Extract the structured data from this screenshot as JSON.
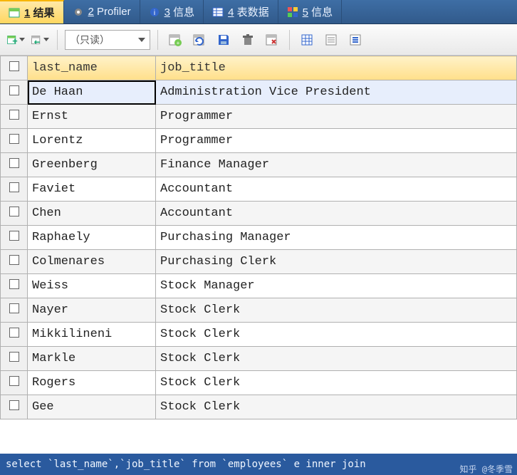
{
  "tabs": [
    {
      "num": "1",
      "label": "结果",
      "active": true,
      "icon": "table"
    },
    {
      "num": "2",
      "label": "Profiler",
      "active": false,
      "icon": "gear"
    },
    {
      "num": "3",
      "label": "信息",
      "active": false,
      "icon": "info"
    },
    {
      "num": "4",
      "label": "表数据",
      "active": false,
      "icon": "grid"
    },
    {
      "num": "5",
      "label": "信息",
      "active": false,
      "icon": "blocks"
    }
  ],
  "toolbar": {
    "mode_label": "（只读）"
  },
  "columns": [
    "last_name",
    "job_title"
  ],
  "rows": [
    {
      "last_name": "De Haan",
      "job_title": "Administration Vice President",
      "selected": true
    },
    {
      "last_name": "Ernst",
      "job_title": "Programmer"
    },
    {
      "last_name": "Lorentz",
      "job_title": "Programmer"
    },
    {
      "last_name": "Greenberg",
      "job_title": "Finance Manager"
    },
    {
      "last_name": "Faviet",
      "job_title": "Accountant"
    },
    {
      "last_name": "Chen",
      "job_title": "Accountant"
    },
    {
      "last_name": "Raphaely",
      "job_title": "Purchasing Manager"
    },
    {
      "last_name": "Colmenares",
      "job_title": "Purchasing Clerk"
    },
    {
      "last_name": "Weiss",
      "job_title": "Stock Manager"
    },
    {
      "last_name": "Nayer",
      "job_title": "Stock Clerk"
    },
    {
      "last_name": "Mikkilineni",
      "job_title": "Stock Clerk"
    },
    {
      "last_name": "Markle",
      "job_title": "Stock Clerk"
    },
    {
      "last_name": "Rogers",
      "job_title": "Stock Clerk"
    },
    {
      "last_name": "Gee",
      "job_title": "Stock Clerk"
    }
  ],
  "sql": "select `last_name`,`job_title` from `employees` e inner join",
  "watermark": "知乎 @冬季雪"
}
